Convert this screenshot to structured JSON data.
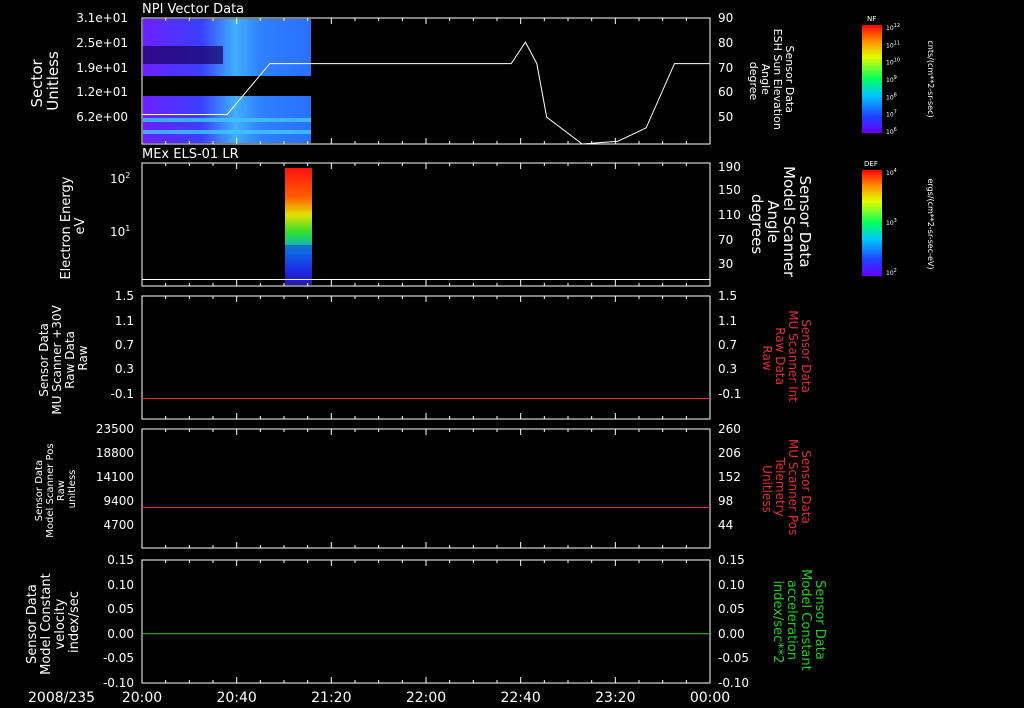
{
  "date_label": "2008/235",
  "time_ticks": [
    "20:00",
    "20:40",
    "21:20",
    "22:00",
    "22:40",
    "23:20",
    "00:00"
  ],
  "time_range_hours": [
    20,
    24
  ],
  "panels": [
    {
      "title": "NPI Vector Data",
      "left_label": [
        "Sector",
        "Unitless"
      ],
      "left_ticks": [
        "3.1e+01",
        "2.5e+01",
        "1.9e+01",
        "1.2e+01",
        "6.2e+00"
      ],
      "right_label": [
        "Sensor Data",
        "ESH Sun Elevation",
        "Angle",
        "degree"
      ],
      "right_ticks": [
        "90",
        "80",
        "70",
        "60",
        "50"
      ],
      "colorbar": {
        "title": "NF",
        "unit": "cnts/(cm**2-sr-sec)",
        "tick_exponents": [
          "12",
          "11",
          "10",
          "9",
          "8",
          "7",
          "6"
        ]
      }
    },
    {
      "title": "MEx ELS-01 LR",
      "left_label": [
        "Electron Energy",
        "eV"
      ],
      "left_ticks": [
        "10",
        "10"
      ],
      "left_tick_exponents": [
        "2",
        "1"
      ],
      "right_label": [
        "Sensor Data",
        "Model Scanner",
        "Angle",
        "degrees"
      ],
      "right_ticks": [
        "190",
        "150",
        "110",
        "70",
        "30"
      ],
      "colorbar": {
        "title": "DEF",
        "unit": "ergs/(cm**2-sr-sec-eV)",
        "tick_exponents": [
          "4",
          "3",
          "2"
        ]
      }
    },
    {
      "title": "",
      "left_label": [
        "Sensor Data",
        "MU Scanner +30V",
        "Raw Data",
        "Raw"
      ],
      "left_ticks": [
        "1.5",
        "1.1",
        "0.7",
        "0.3",
        "-0.1"
      ],
      "right_label": [
        "Sensor Data",
        "MU Scanner Int",
        "Raw Data",
        "Raw"
      ],
      "right_ticks": [
        "1.5",
        "1.1",
        "0.7",
        "0.3",
        "-0.1"
      ]
    },
    {
      "title": "",
      "left_label": [
        "Sensor Data",
        "Model Scanner Pos",
        "Raw",
        "unitless"
      ],
      "left_ticks": [
        "23500",
        "18800",
        "14100",
        "9400",
        "4700"
      ],
      "right_label": [
        "Sensor Data",
        "MU Scanner Pos",
        "Telemetry",
        "Unitless"
      ],
      "right_ticks": [
        "260",
        "206",
        "152",
        "98",
        "44"
      ]
    },
    {
      "title": "",
      "left_label": [
        "Sensor Data",
        "Model Constant",
        "velocity",
        "index/sec"
      ],
      "left_ticks": [
        "0.15",
        "0.10",
        "0.05",
        "0.00",
        "-0.05",
        "-0.10"
      ],
      "right_label": [
        "Sensor Data",
        "Model Constant",
        "acceleration",
        "index/sec**2"
      ],
      "right_ticks": [
        "0.15",
        "0.10",
        "0.05",
        "0.00",
        "-0.05",
        "-0.10"
      ]
    }
  ],
  "colors": {
    "background": "#000000",
    "axis": "#ffffff",
    "red_trace": "#e23030",
    "green_trace": "#22cc22"
  },
  "chart_data": [
    {
      "type": "line",
      "name": "ESH Sun Elevation Angle",
      "x": [
        20.0,
        20.6,
        20.9,
        22.6,
        22.7,
        22.78,
        22.85,
        23.1,
        23.35,
        23.55,
        23.75,
        24.0
      ],
      "y": [
        54,
        54,
        73,
        73,
        81,
        73,
        53,
        43,
        44,
        49,
        73,
        73
      ],
      "ylim": [
        43,
        90
      ],
      "xlim": [
        20,
        24
      ]
    },
    {
      "type": "heatmap",
      "name": "NPI Vector Data sector spectrogram",
      "x_range": [
        20.0,
        21.17
      ],
      "y_range": [
        0,
        31
      ],
      "note_gap_sector": [
        13,
        18
      ]
    },
    {
      "type": "heatmap",
      "name": "MEx ELS-01 LR electron spectrogram",
      "x_range": [
        20.95,
        21.17
      ],
      "y_range_eV": [
        1,
        150
      ],
      "scale": "log"
    },
    {
      "type": "line",
      "name": "Model Scanner Angle",
      "x": [
        20.0,
        24.0
      ],
      "y": [
        10,
        10
      ],
      "ylim": [
        0,
        190
      ]
    },
    {
      "type": "line",
      "name": "MU Scanner +30V Raw",
      "x": [
        20.0,
        24.0
      ],
      "y": [
        0.0,
        0.0
      ],
      "ylim": [
        -0.3,
        1.5
      ]
    },
    {
      "type": "line",
      "name": "Model Scanner Pos Raw",
      "x": [
        20.0,
        24.0
      ],
      "y": [
        8000,
        8000
      ],
      "ylim": [
        0,
        23500
      ]
    },
    {
      "type": "line",
      "name": "Model Constant velocity",
      "x": [
        20.0,
        24.0
      ],
      "y": [
        0.0,
        0.0
      ],
      "ylim": [
        -0.1,
        0.15
      ]
    }
  ]
}
